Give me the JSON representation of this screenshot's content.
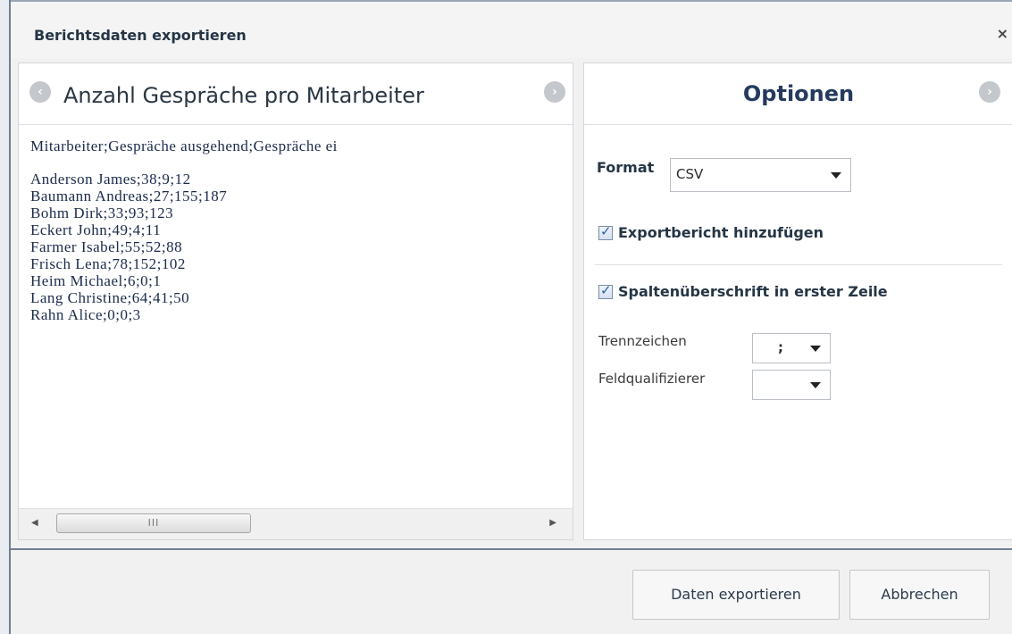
{
  "dialog": {
    "title": "Berichtsdaten exportieren",
    "close_label": "×"
  },
  "preview": {
    "title": "Anzahl Gespräche pro Mitarbeiter",
    "header_line": "Mitarbeiter;Gespräche ausgehend;Gespräche ei",
    "lines": [
      "Anderson James;38;9;12",
      "Baumann Andreas;27;155;187",
      "Bohm Dirk;33;93;123",
      "Eckert John;49;4;11",
      "Farmer Isabel;55;52;88",
      "Frisch Lena;78;152;102",
      "Heim Michael;6;0;1",
      "Lang Christine;64;41;50",
      "Rahn Alice;0;0;3"
    ],
    "scroll_thumb_grip": "III"
  },
  "options": {
    "title": "Optionen",
    "format_label": "Format",
    "format_value": "CSV",
    "export_report_label": "Exportbericht hinzufügen",
    "export_report_checked": true,
    "header_row_label": "Spaltenüberschrift in erster Zeile",
    "header_row_checked": true,
    "separator_label": "Trennzeichen",
    "separator_value": ";",
    "qualifier_label": "Feldqualifizierer",
    "qualifier_value": ""
  },
  "footer": {
    "export_button": "Daten exportieren",
    "cancel_button": "Abbrechen"
  }
}
